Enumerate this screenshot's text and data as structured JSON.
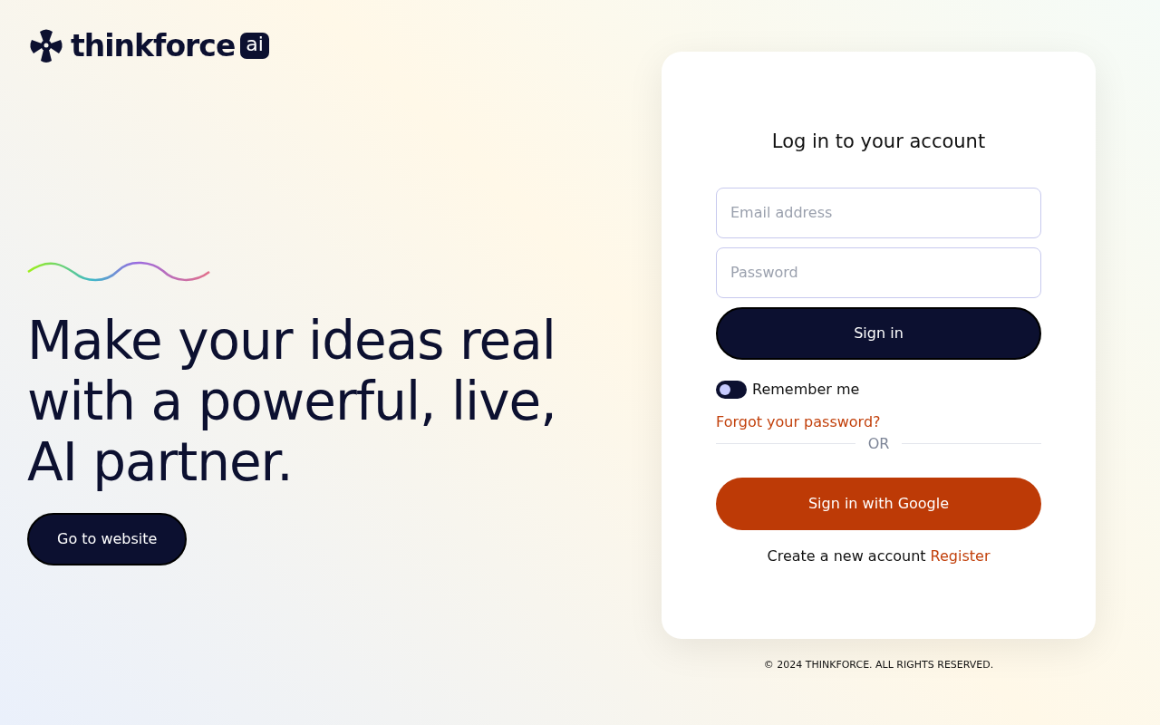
{
  "brand": {
    "name": "thinkforce",
    "badge": "ai"
  },
  "hero": {
    "headline": "Make your ideas real with a powerful, live, AI partner.",
    "button": "Go to website"
  },
  "login": {
    "title": "Log in to your account",
    "email": {
      "placeholder": "Email address"
    },
    "password": {
      "placeholder": "Password"
    },
    "sign_in": "Sign in",
    "remember": {
      "label": "Remember me",
      "on": false
    },
    "forgot": "Forgot your password?",
    "divider": "OR",
    "google": "Sign in with Google",
    "register_prompt": "Create a new account",
    "register_link": "Register"
  },
  "footer": "© 2024 THINKFORCE. ALL RIGHTS RESERVED."
}
